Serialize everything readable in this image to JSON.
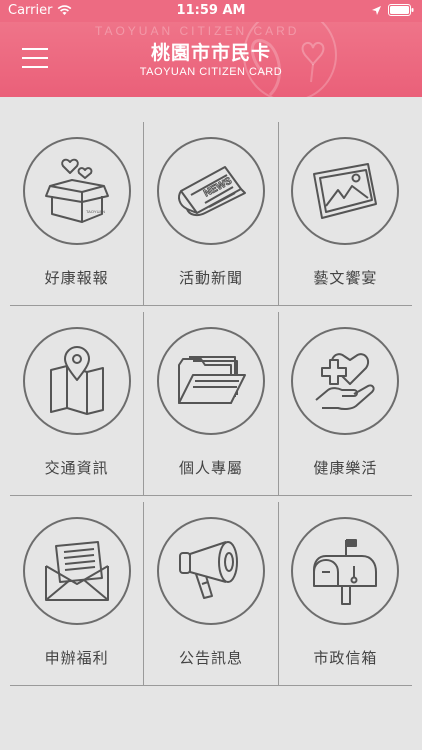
{
  "status_bar": {
    "carrier": "Carrier",
    "time": "11:59 AM"
  },
  "header": {
    "title": "桃園市市民卡",
    "subtitle": "TAOYUAN CITIZEN CARD",
    "watermark": "TAOYUAN CITIZEN CARD"
  },
  "colors": {
    "header": "#ed6b82",
    "background": "#e5e5e5",
    "icon_stroke": "#6d6d6d"
  },
  "grid": [
    [
      {
        "label": "好康報報",
        "icon": "gift-box-icon"
      },
      {
        "label": "活動新聞",
        "icon": "newspaper-icon"
      },
      {
        "label": "藝文饗宴",
        "icon": "picture-frame-icon"
      }
    ],
    [
      {
        "label": "交通資訊",
        "icon": "map-pin-icon"
      },
      {
        "label": "個人專屬",
        "icon": "folder-icon"
      },
      {
        "label": "健康樂活",
        "icon": "health-heart-icon"
      }
    ],
    [
      {
        "label": "申辦福利",
        "icon": "envelope-icon"
      },
      {
        "label": "公告訊息",
        "icon": "megaphone-icon"
      },
      {
        "label": "市政信箱",
        "icon": "mailbox-icon"
      }
    ]
  ],
  "icons": {
    "box_text": "TAOYUAN",
    "news_text": "NEWS"
  }
}
